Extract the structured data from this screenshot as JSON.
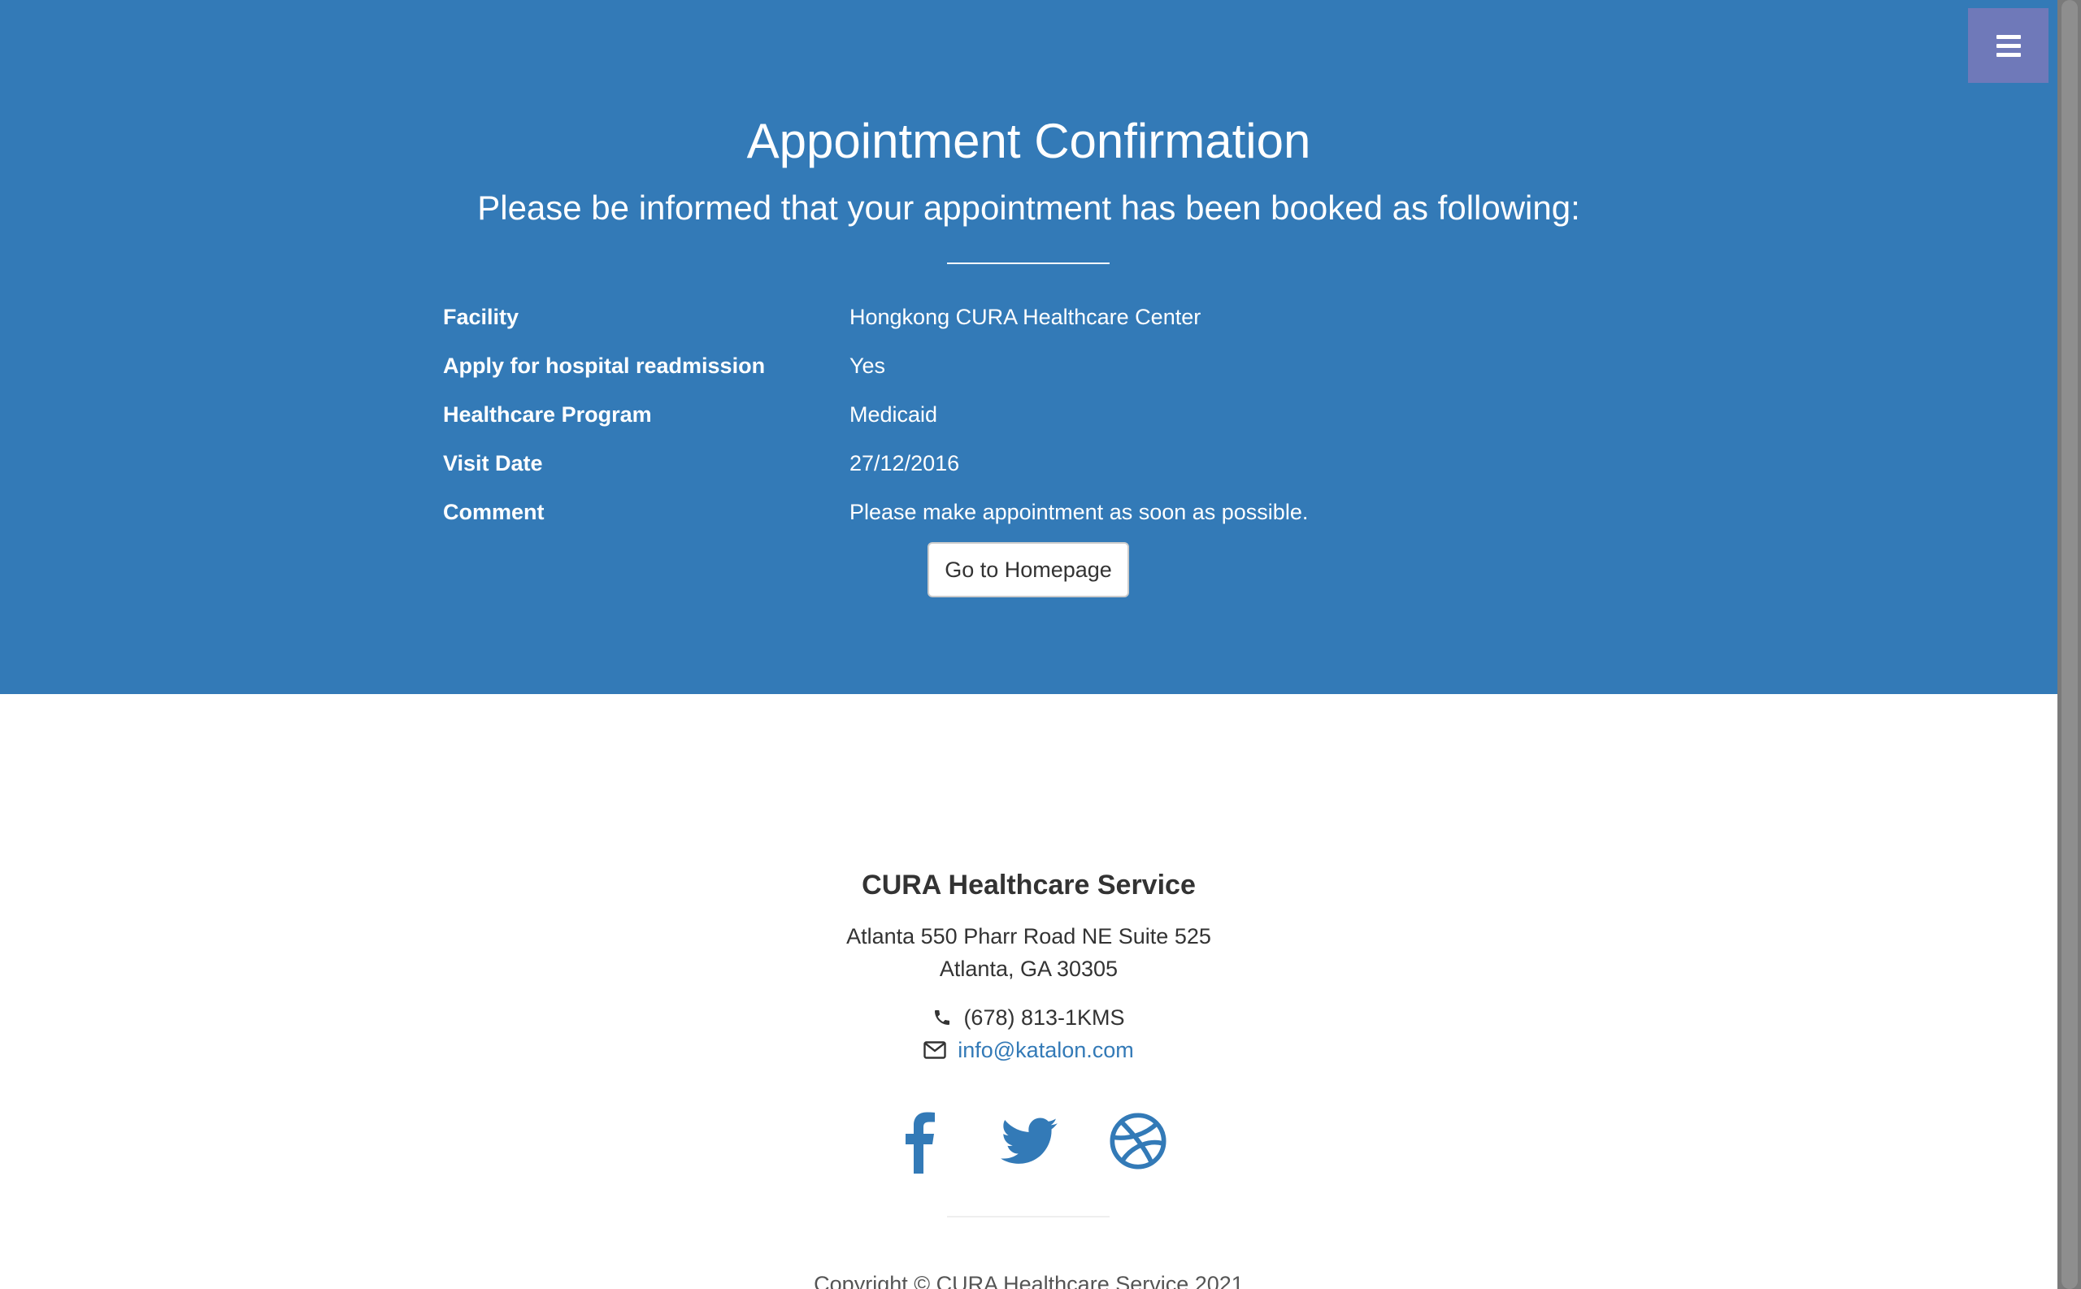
{
  "header": {
    "menu_icon": "bars-icon",
    "title": "Appointment Confirmation",
    "subtitle": "Please be informed that your appointment has been booked as following:"
  },
  "appointment": {
    "rows": [
      {
        "label": "Facility",
        "value": "Hongkong CURA Healthcare Center"
      },
      {
        "label": "Apply for hospital readmission",
        "value": "Yes"
      },
      {
        "label": "Healthcare Program",
        "value": "Medicaid"
      },
      {
        "label": "Visit Date",
        "value": "27/12/2016"
      },
      {
        "label": "Comment",
        "value": "Please make appointment as soon as possible."
      }
    ],
    "home_button_label": "Go to Homepage"
  },
  "footer": {
    "company": "CURA Healthcare Service",
    "address_line1": "Atlanta 550 Pharr Road NE Suite 525",
    "address_line2": "Atlanta, GA 30305",
    "phone": "(678) 813-1KMS",
    "email": "info@katalon.com",
    "social": [
      "facebook-icon",
      "twitter-icon",
      "dribbble-icon"
    ],
    "copyright": "Copyright © CURA Healthcare Service 2021"
  },
  "colors": {
    "primary": "#337ab7",
    "menu_toggle": "#6f79b9",
    "text_dark": "#333333"
  }
}
